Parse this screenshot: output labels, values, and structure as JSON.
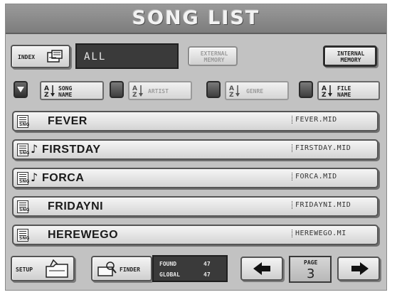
{
  "title": "SONG LIST",
  "toolbar": {
    "index_label": "INDEX",
    "filter_value": "ALL",
    "external_memory_label": "EXTERNAL MEMORY",
    "internal_memory_label": "INTERNAL MEMORY"
  },
  "sort": {
    "song_name": "SONG NAME",
    "artist": "ARTIST",
    "genre": "GENRE",
    "file_name": "FILE NAME"
  },
  "songs": [
    {
      "name": "FEVER",
      "file": "FEVER.MID",
      "has_note": false
    },
    {
      "name": "FIRSTDAY",
      "file": "FIRSTDAY.MID",
      "has_note": true
    },
    {
      "name": "FORCA",
      "file": "FORCA.MID",
      "has_note": true
    },
    {
      "name": "FRIDAYNI",
      "file": "FRIDAYNI.MID",
      "has_note": false
    },
    {
      "name": "HEREWEGO",
      "file": "HEREWEGO.MI",
      "has_note": false
    }
  ],
  "footer": {
    "setup_label": "SETUP",
    "finder_label": "FINDER",
    "found_label": "FOUND",
    "found_value": "47",
    "global_label": "GLOBAL",
    "global_value": "47",
    "page_label": "PAGE",
    "page_value": "3"
  }
}
